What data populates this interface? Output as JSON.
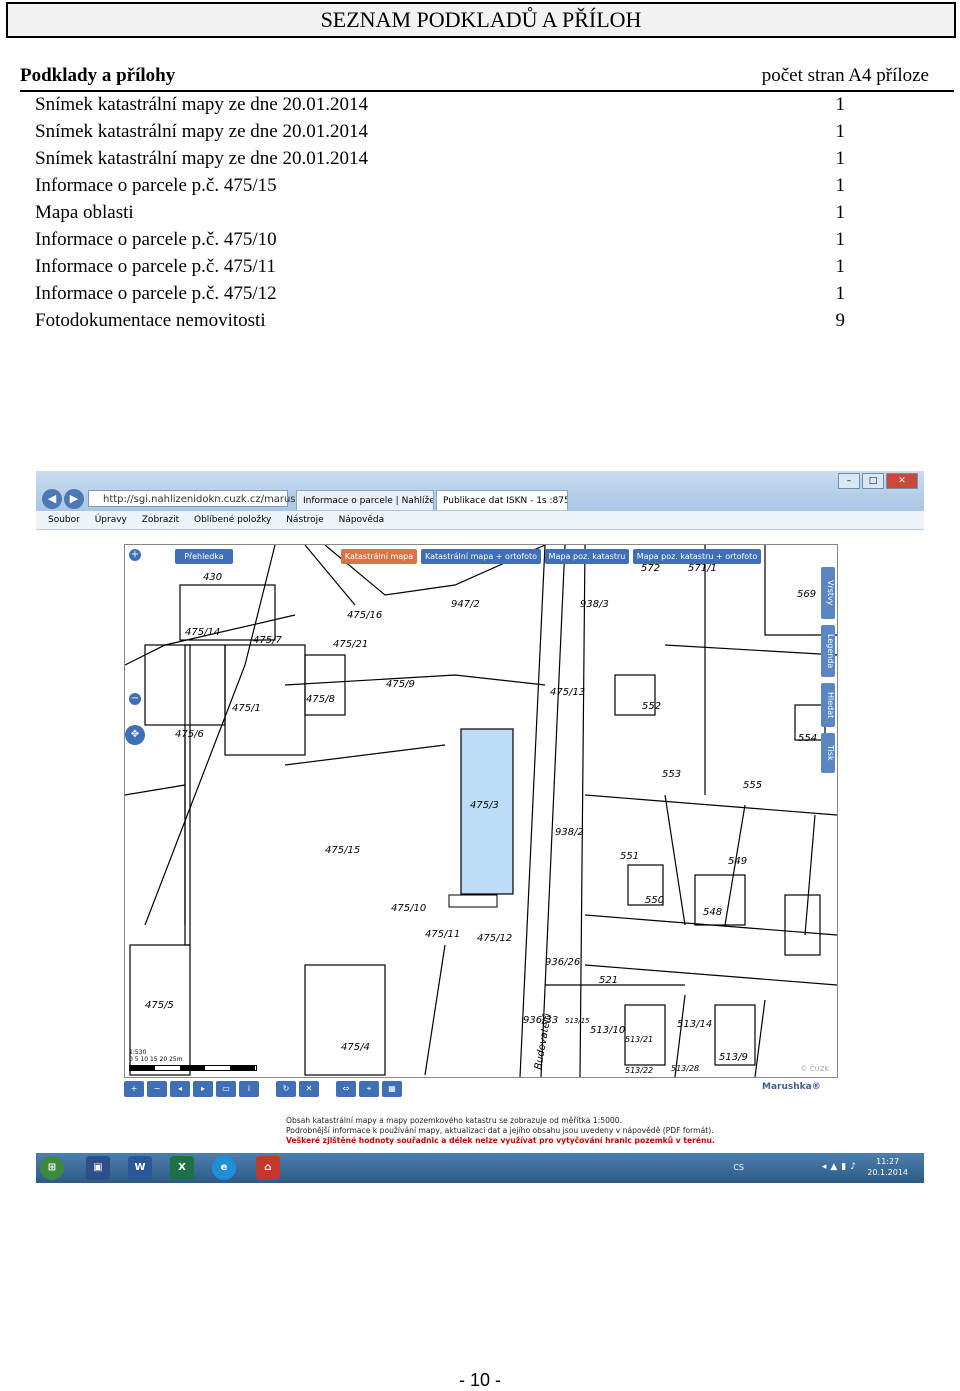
{
  "title": "SEZNAM PODKLADŮ A PŘÍLOH",
  "list": {
    "header_left": "Podklady a přílohy",
    "header_right": "počet stran A4 příloze",
    "rows": [
      {
        "label": "Snímek katastrální mapy ze dne 20.01.2014",
        "count": "1"
      },
      {
        "label": "Snímek katastrální mapy ze dne 20.01.2014",
        "count": "1"
      },
      {
        "label": "Snímek katastrální mapy ze dne 20.01.2014",
        "count": "1"
      },
      {
        "label": "Informace o parcele p.č. 475/15",
        "count": "1"
      },
      {
        "label": "Mapa oblasti",
        "count": "1"
      },
      {
        "label": "Informace o parcele p.č. 475/10",
        "count": "1"
      },
      {
        "label": "Informace o parcele p.č. 475/11",
        "count": "1"
      },
      {
        "label": "Informace o parcele p.č. 475/12",
        "count": "1"
      },
      {
        "label": "Fotodokumentace nemovitosti",
        "count": "9"
      }
    ]
  },
  "screenshot": {
    "address": "http://sgi.nahlizenidokn.cuzk.cz/marushl",
    "tabs": [
      "Informace o parcele | Nahlížení...",
      "Publikace dat ISKN - 1s :875..."
    ],
    "menu": [
      "Soubor",
      "Úpravy",
      "Zobrazit",
      "Oblíbené položky",
      "Nástroje",
      "Nápověda"
    ],
    "map_tabs": [
      "Přehledka",
      "Katastrální mapa",
      "Katastrální mapa + ortofoto",
      "Mapa poz. katastru",
      "Mapa poz. katastru + ortofoto"
    ],
    "side_tabs": [
      "Vrstvy",
      "Legenda",
      "Hledat",
      "Tisk"
    ],
    "parcels": [
      "430",
      "475/14",
      "475/7",
      "475/16",
      "475/21",
      "947/2",
      "938/3",
      "572",
      "571/1",
      "569",
      "475/8",
      "475/9",
      "475/13",
      "475/1",
      "475/6",
      "552",
      "554",
      "553",
      "555",
      "475/3",
      "938/2",
      "475/15",
      "551",
      "549",
      "550",
      "548",
      "475/10",
      "475/11",
      "475/12",
      "936/26",
      "521",
      "475/5",
      "936/33",
      "513/15",
      "513/10",
      "513/14",
      "513/21",
      "475/4",
      "513/9",
      "513/22",
      "513/28"
    ],
    "street": "Budovatelů",
    "scale_label": "1:530",
    "scale_ticks": "0  5  10  15  20  25m",
    "cuzk_mark": "© ČÚZK",
    "brand": "Marushka®",
    "notice_lines": [
      "Obsah katastrální mapy a mapy pozemkového katastru se zobrazuje od měřítka 1:5000.",
      "Podrobnější informace k používání mapy, aktualizaci dat a jejího obsahu jsou uvedeny v nápovědě (PDF formát).",
      "Veškeré zjištěné hodnoty souřadnic a délek nelze využívat pro vytyčování hranic pozemků v terénu."
    ],
    "taskbar_lang": "CS",
    "clock_time": "11:27",
    "clock_date": "20.1.2014"
  },
  "page_number": "- 10 -"
}
